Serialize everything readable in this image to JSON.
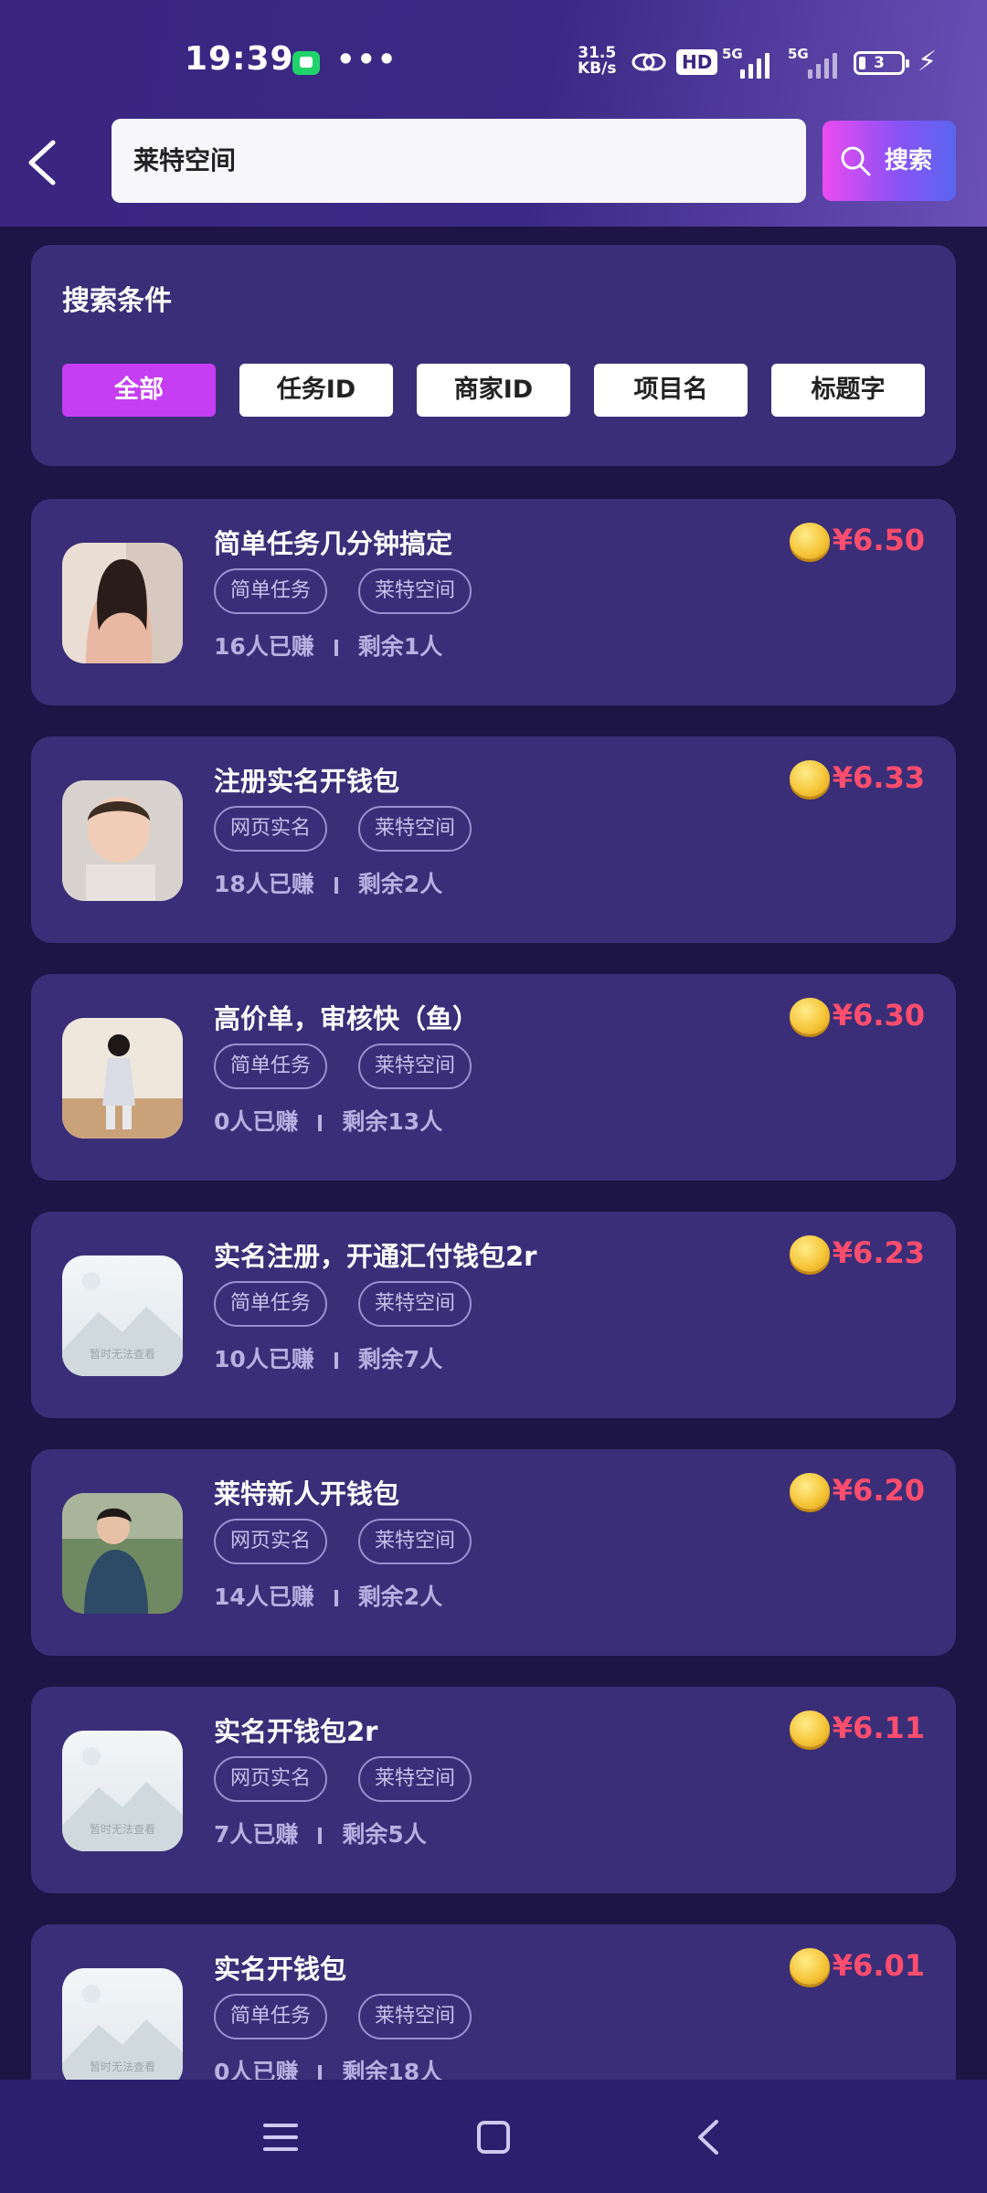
{
  "status_bar": {
    "time": "19:39",
    "dots": "•••",
    "net_speed_value": "31.5",
    "net_speed_unit": "KB/s",
    "hd_label": "HD",
    "signal1_label": "5G",
    "signal2_label": "5G",
    "battery_level": "3"
  },
  "search": {
    "query": "莱特空间",
    "button_label": "搜索"
  },
  "filter": {
    "title": "搜索条件",
    "options": [
      "全部",
      "任务ID",
      "商家ID",
      "项目名",
      "标题字"
    ],
    "selected": "全部"
  },
  "placeholder_text": "暂时无法查看",
  "tasks": [
    {
      "title": "简单任务几分钟搞定",
      "tags": [
        "简单任务",
        "莱特空间"
      ],
      "earned": "16人已赚",
      "remaining": "剩余1人",
      "price": "¥6.50",
      "thumb": "photo-woman"
    },
    {
      "title": "注册实名开钱包",
      "tags": [
        "网页实名",
        "莱特空间"
      ],
      "earned": "18人已赚",
      "remaining": "剩余2人",
      "price": "¥6.33",
      "thumb": "photo-baby"
    },
    {
      "title": "高价单，审核快（鱼）",
      "tags": [
        "简单任务",
        "莱特空间"
      ],
      "earned": "0人已赚",
      "remaining": "剩余13人",
      "price": "¥6.30",
      "thumb": "photo-girl"
    },
    {
      "title": "实名注册，开通汇付钱包2r",
      "tags": [
        "简单任务",
        "莱特空间"
      ],
      "earned": "10人已赚",
      "remaining": "剩余7人",
      "price": "¥6.23",
      "thumb": "placeholder"
    },
    {
      "title": "莱特新人开钱包",
      "tags": [
        "网页实名",
        "莱特空间"
      ],
      "earned": "14人已赚",
      "remaining": "剩余2人",
      "price": "¥6.20",
      "thumb": "photo-man"
    },
    {
      "title": "实名开钱包2r",
      "tags": [
        "网页实名",
        "莱特空间"
      ],
      "earned": "7人已赚",
      "remaining": "剩余5人",
      "price": "¥6.11",
      "thumb": "placeholder"
    },
    {
      "title": "实名开钱包",
      "tags": [
        "简单任务",
        "莱特空间"
      ],
      "earned": "0人已赚",
      "remaining": "剩余18人",
      "price": "¥6.01",
      "thumb": "placeholder"
    }
  ],
  "colors": {
    "background": "#1c1545",
    "card": "#3a2e78",
    "accent": "#c53ef3",
    "price": "#ff4d6d"
  },
  "icons": [
    "back-arrow-icon",
    "search-icon",
    "coin-icon",
    "menu-icon",
    "home-icon",
    "nav-back-icon"
  ]
}
